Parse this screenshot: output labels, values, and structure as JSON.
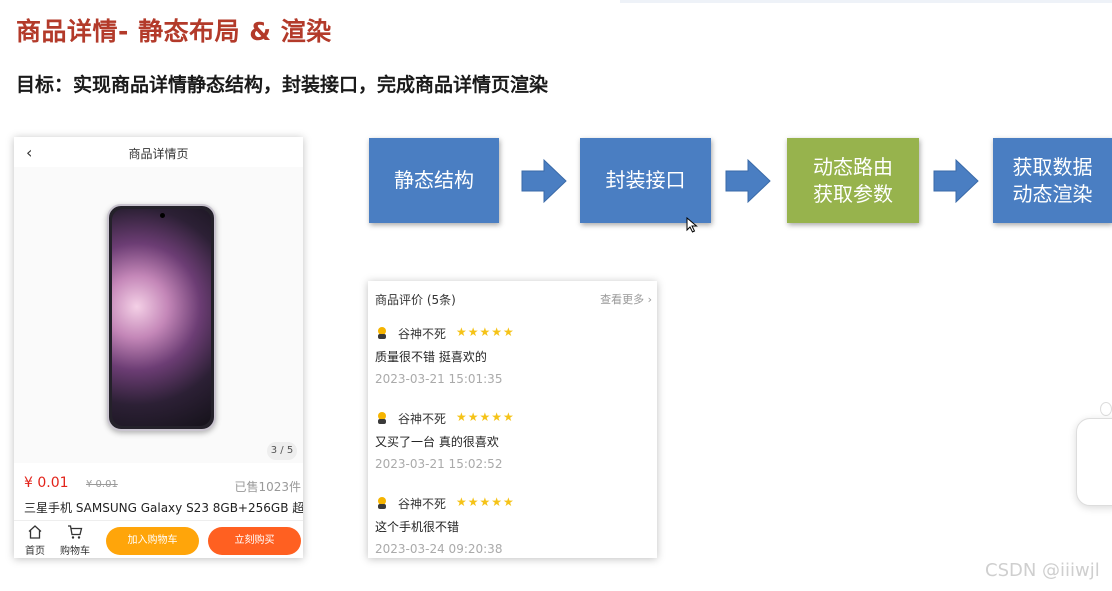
{
  "slide": {
    "title": "商品详情- 静态布局 & 渲染",
    "goal": "目标：实现商品详情静态结构，封装接口，完成商品详情页渲染"
  },
  "phone": {
    "back_icon": "chevron-left-icon",
    "header_title": "商品详情页",
    "gallery_indicator": "3 / 5",
    "price_now": "¥ 0.01",
    "price_old": "¥ 0.01",
    "sold": "已售1023件",
    "product_name": "三星手机 SAMSUNG Galaxy S23 8GB+256GB 超",
    "nav": {
      "home_label": "首页",
      "home_icon": "home-icon",
      "cart_label": "购物车",
      "cart_icon": "cart-icon"
    },
    "add_cart_label": "加入购物车",
    "buy_label": "立刻购买",
    "colors": {
      "price": "#e2231a",
      "cart_btn": "#ffa50a",
      "buy_btn": "#ff6021"
    }
  },
  "flow": {
    "steps": [
      {
        "lines": [
          "静态结构"
        ],
        "color": "#4a7ec2"
      },
      {
        "lines": [
          "封装接口"
        ],
        "color": "#4a7ec2"
      },
      {
        "lines": [
          "动态路由",
          "获取参数"
        ],
        "color": "#97b34d"
      },
      {
        "lines": [
          "获取数据",
          "动态渲染"
        ],
        "color": "#4a7ec2"
      }
    ],
    "arrow_icon": "right-arrow-icon"
  },
  "reviews": {
    "title": "商品评价 (5条)",
    "more": "查看更多",
    "items": [
      {
        "user": "谷神不死",
        "stars": 5,
        "text": "质量很不错 挺喜欢的",
        "time": "2023-03-21 15:01:35"
      },
      {
        "user": "谷神不死",
        "stars": 5,
        "text": "又买了一台 真的很喜欢",
        "time": "2023-03-21 15:02:52"
      },
      {
        "user": "谷神不死",
        "stars": 5,
        "text": "这个手机很不错",
        "time": "2023-03-24 09:20:38"
      }
    ]
  },
  "watermark": "CSDN @iiiwjl"
}
